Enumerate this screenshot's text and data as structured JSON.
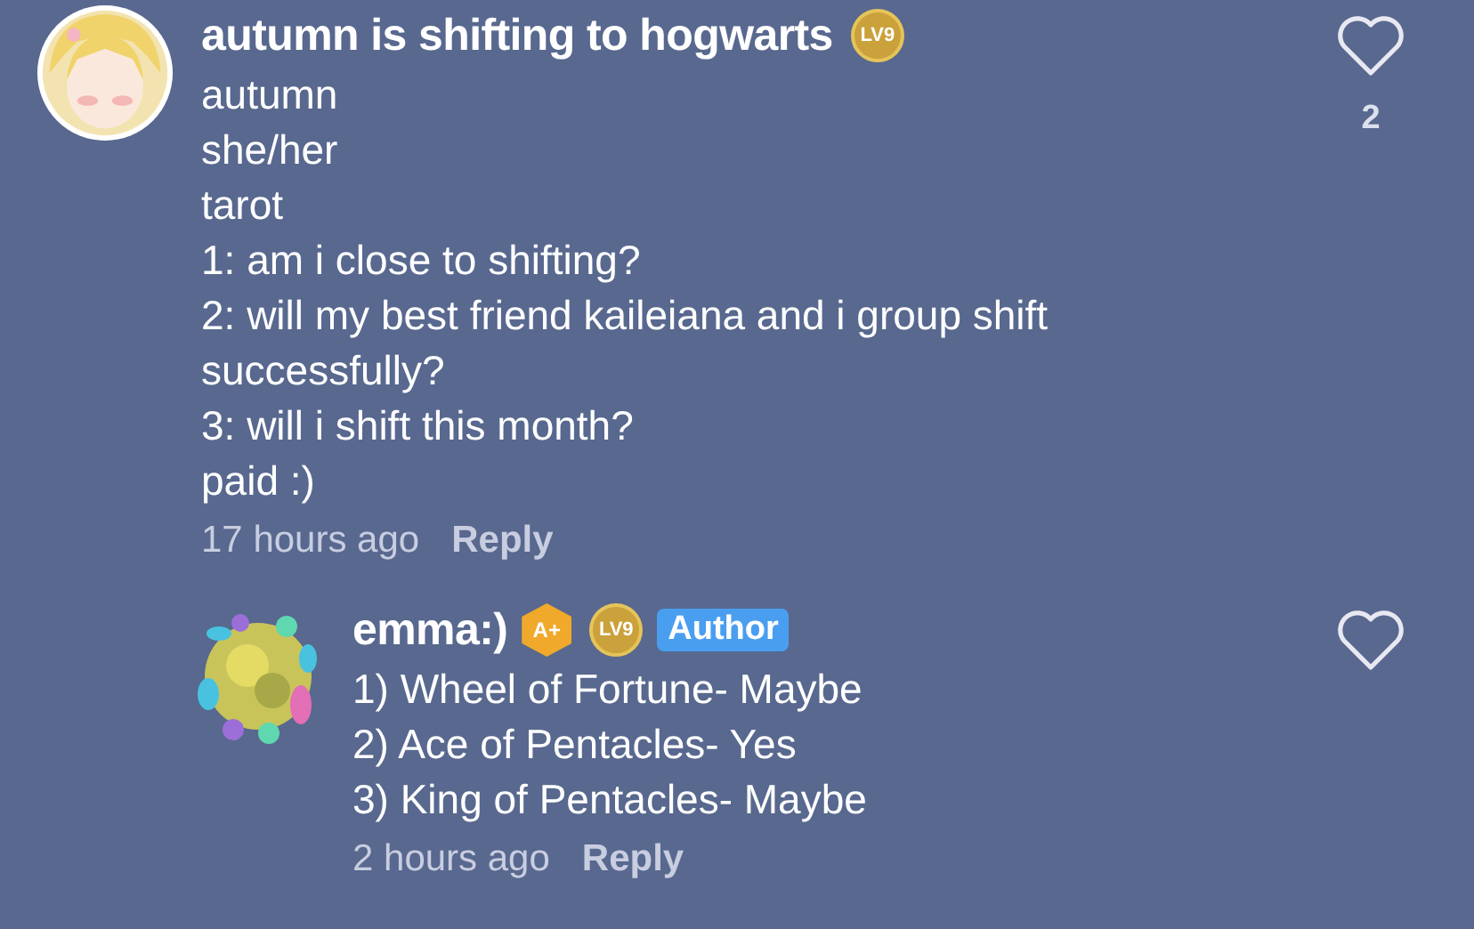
{
  "comments": [
    {
      "author": "autumn is shifting to hogwarts",
      "indent": false,
      "badges": [
        {
          "kind": "level",
          "label": "LV9"
        }
      ],
      "lines": [
        "autumn",
        "she/her",
        "tarot",
        "1: am i close to shifting?",
        "2: will my best friend kaileiana and i group shift successfully?",
        "3: will i shift this month?",
        "paid :)"
      ],
      "time": "17 hours ago",
      "reply": "Reply",
      "liked": false,
      "likes": "2",
      "avatar": {
        "kind": "picture"
      }
    },
    {
      "author": "emma:)",
      "indent": true,
      "badges": [
        {
          "kind": "rank",
          "label": "A+"
        },
        {
          "kind": "level",
          "label": "LV9"
        },
        {
          "kind": "tag",
          "label": "Author"
        }
      ],
      "lines": [
        "1) Wheel of Fortune- Maybe",
        "2) Ace of Pentacles- Yes",
        "3) King of Pentacles- Maybe"
      ],
      "time": "2 hours ago",
      "reply": "Reply",
      "liked": false,
      "avatar": {
        "kind": "picture"
      }
    }
  ]
}
